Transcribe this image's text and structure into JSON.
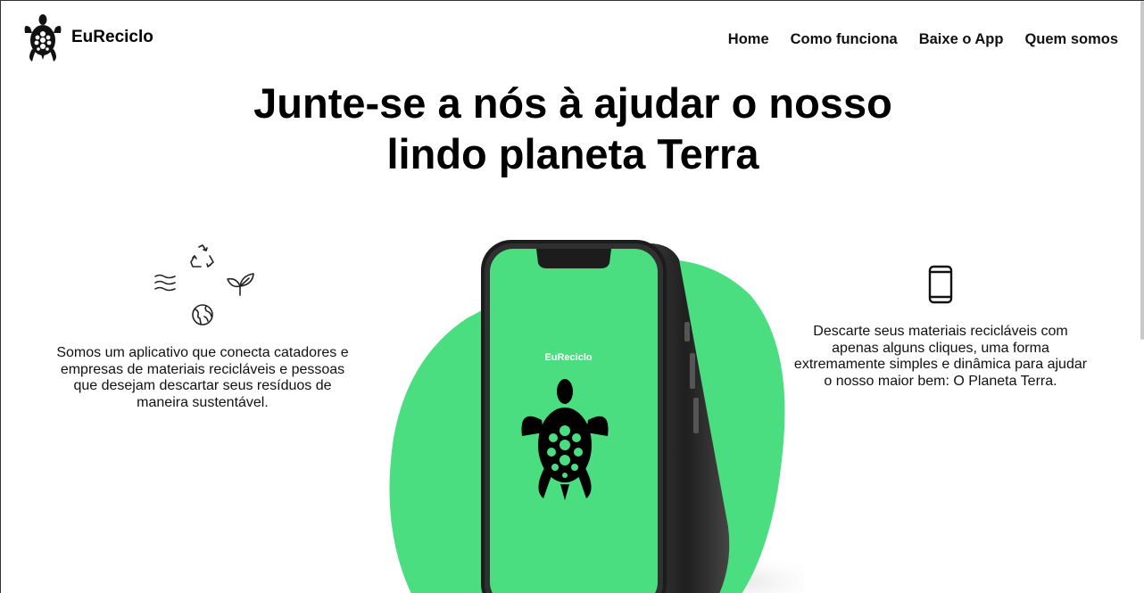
{
  "brand": {
    "name": "EuReciclo",
    "logo_icon": "turtle-icon"
  },
  "nav": {
    "items": [
      {
        "label": "Home"
      },
      {
        "label": "Como funciona"
      },
      {
        "label": "Baixe o App"
      },
      {
        "label": "Quem somos"
      }
    ]
  },
  "hero": {
    "title_line1": "Junte-se a nós à ajudar o nosso",
    "title_line2": "lindo planeta Terra"
  },
  "left_feature": {
    "icons": [
      "recycle-icon",
      "wind-icon",
      "leaf-icon",
      "globe-icon"
    ],
    "text": "Somos um aplicativo que conecta catadores e empresas de materiais recicláveis e pessoas que desejam descartar seus resíduos de maneira sustentável."
  },
  "phone_mockup": {
    "screen_app_name": "EuReciclo",
    "screen_icon": "turtle-icon"
  },
  "right_feature": {
    "icon": "smartphone-icon",
    "text": "Descarte seus materiais recicláveis com apenas alguns cliques, uma forma extremamente simples e dinâmica para ajudar o nosso maior bem: O Planeta Terra."
  },
  "colors": {
    "accent_green": "#4ade80",
    "text": "#111111",
    "phone_body": "#2b2b2b"
  }
}
